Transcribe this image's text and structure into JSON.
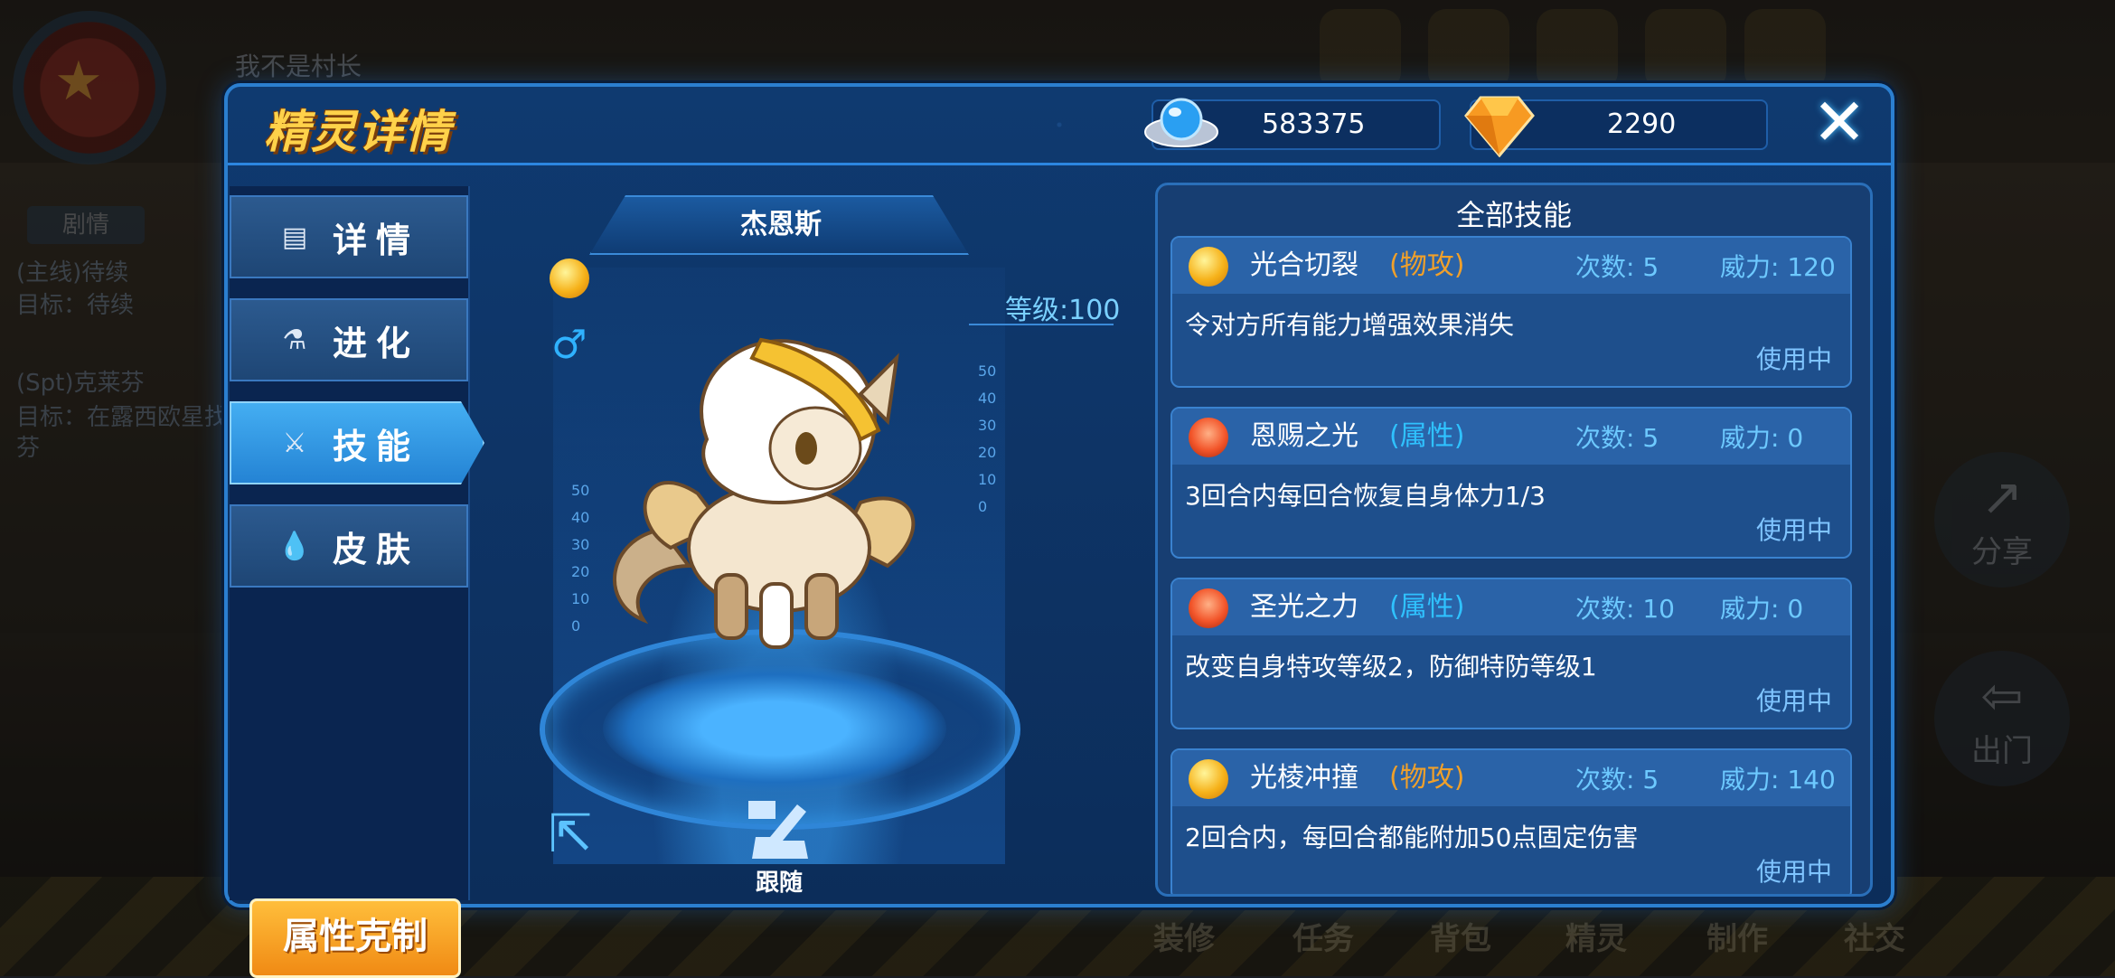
{
  "background": {
    "player_name": "我不是村长",
    "quest_tab": "剧情",
    "quests": [
      "(主线)待续",
      "目标：待续",
      "(Spt)克莱芬",
      "目标：在露西欧星找",
      "芬"
    ],
    "side_buttons": [
      "分享",
      "出门"
    ],
    "bottom_nav": [
      "装修",
      "任务",
      "背包",
      "精灵",
      "制作",
      "社交"
    ]
  },
  "dialog": {
    "title": "精灵详情",
    "currency": [
      {
        "icon": "saucer-coin-icon",
        "value": "583375"
      },
      {
        "icon": "diamond-icon",
        "value": "2290"
      }
    ],
    "close_label": "✕"
  },
  "tabs": [
    {
      "label": "详情",
      "icon": "details-icon",
      "active": false
    },
    {
      "label": "进化",
      "icon": "flask-icon",
      "active": false
    },
    {
      "label": "技能",
      "icon": "sword-icon",
      "active": true
    },
    {
      "label": "皮肤",
      "icon": "drop-icon",
      "active": false
    }
  ],
  "type_chart_button": "属性克制",
  "pet": {
    "name": "杰恩斯",
    "level_text": "等级:100",
    "gender_symbol": "♂",
    "follow_label": "跟随",
    "scale_left": [
      "50",
      "40",
      "30",
      "20",
      "10",
      "0"
    ],
    "scale_right": [
      "50",
      "40",
      "30",
      "20",
      "10",
      "0"
    ]
  },
  "skills_panel": {
    "title": "全部技能",
    "skills": [
      {
        "icon": "light",
        "name": "光合切裂",
        "category": "(物攻)",
        "cat_type": "physical",
        "pp": "次数: 5",
        "power": "威力: 120",
        "desc": "令对方所有能力增强效果消失",
        "status": "使用中"
      },
      {
        "icon": "attr",
        "name": "恩赐之光",
        "category": "(属性)",
        "cat_type": "status",
        "pp": "次数: 5",
        "power": "威力: 0",
        "desc": "3回合内每回合恢复自身体力1/3",
        "status": "使用中"
      },
      {
        "icon": "attr",
        "name": "圣光之力",
        "category": "(属性)",
        "cat_type": "status",
        "pp": "次数: 10",
        "power": "威力: 0",
        "desc": "改变自身特攻等级2，防御特防等级1",
        "status": "使用中"
      },
      {
        "icon": "light",
        "name": "光棱冲撞",
        "category": "(物攻)",
        "cat_type": "physical",
        "pp": "次数: 5",
        "power": "威力: 140",
        "desc": "2回合内，每回合都能附加50点固定伤害",
        "status": "使用中"
      }
    ]
  }
}
